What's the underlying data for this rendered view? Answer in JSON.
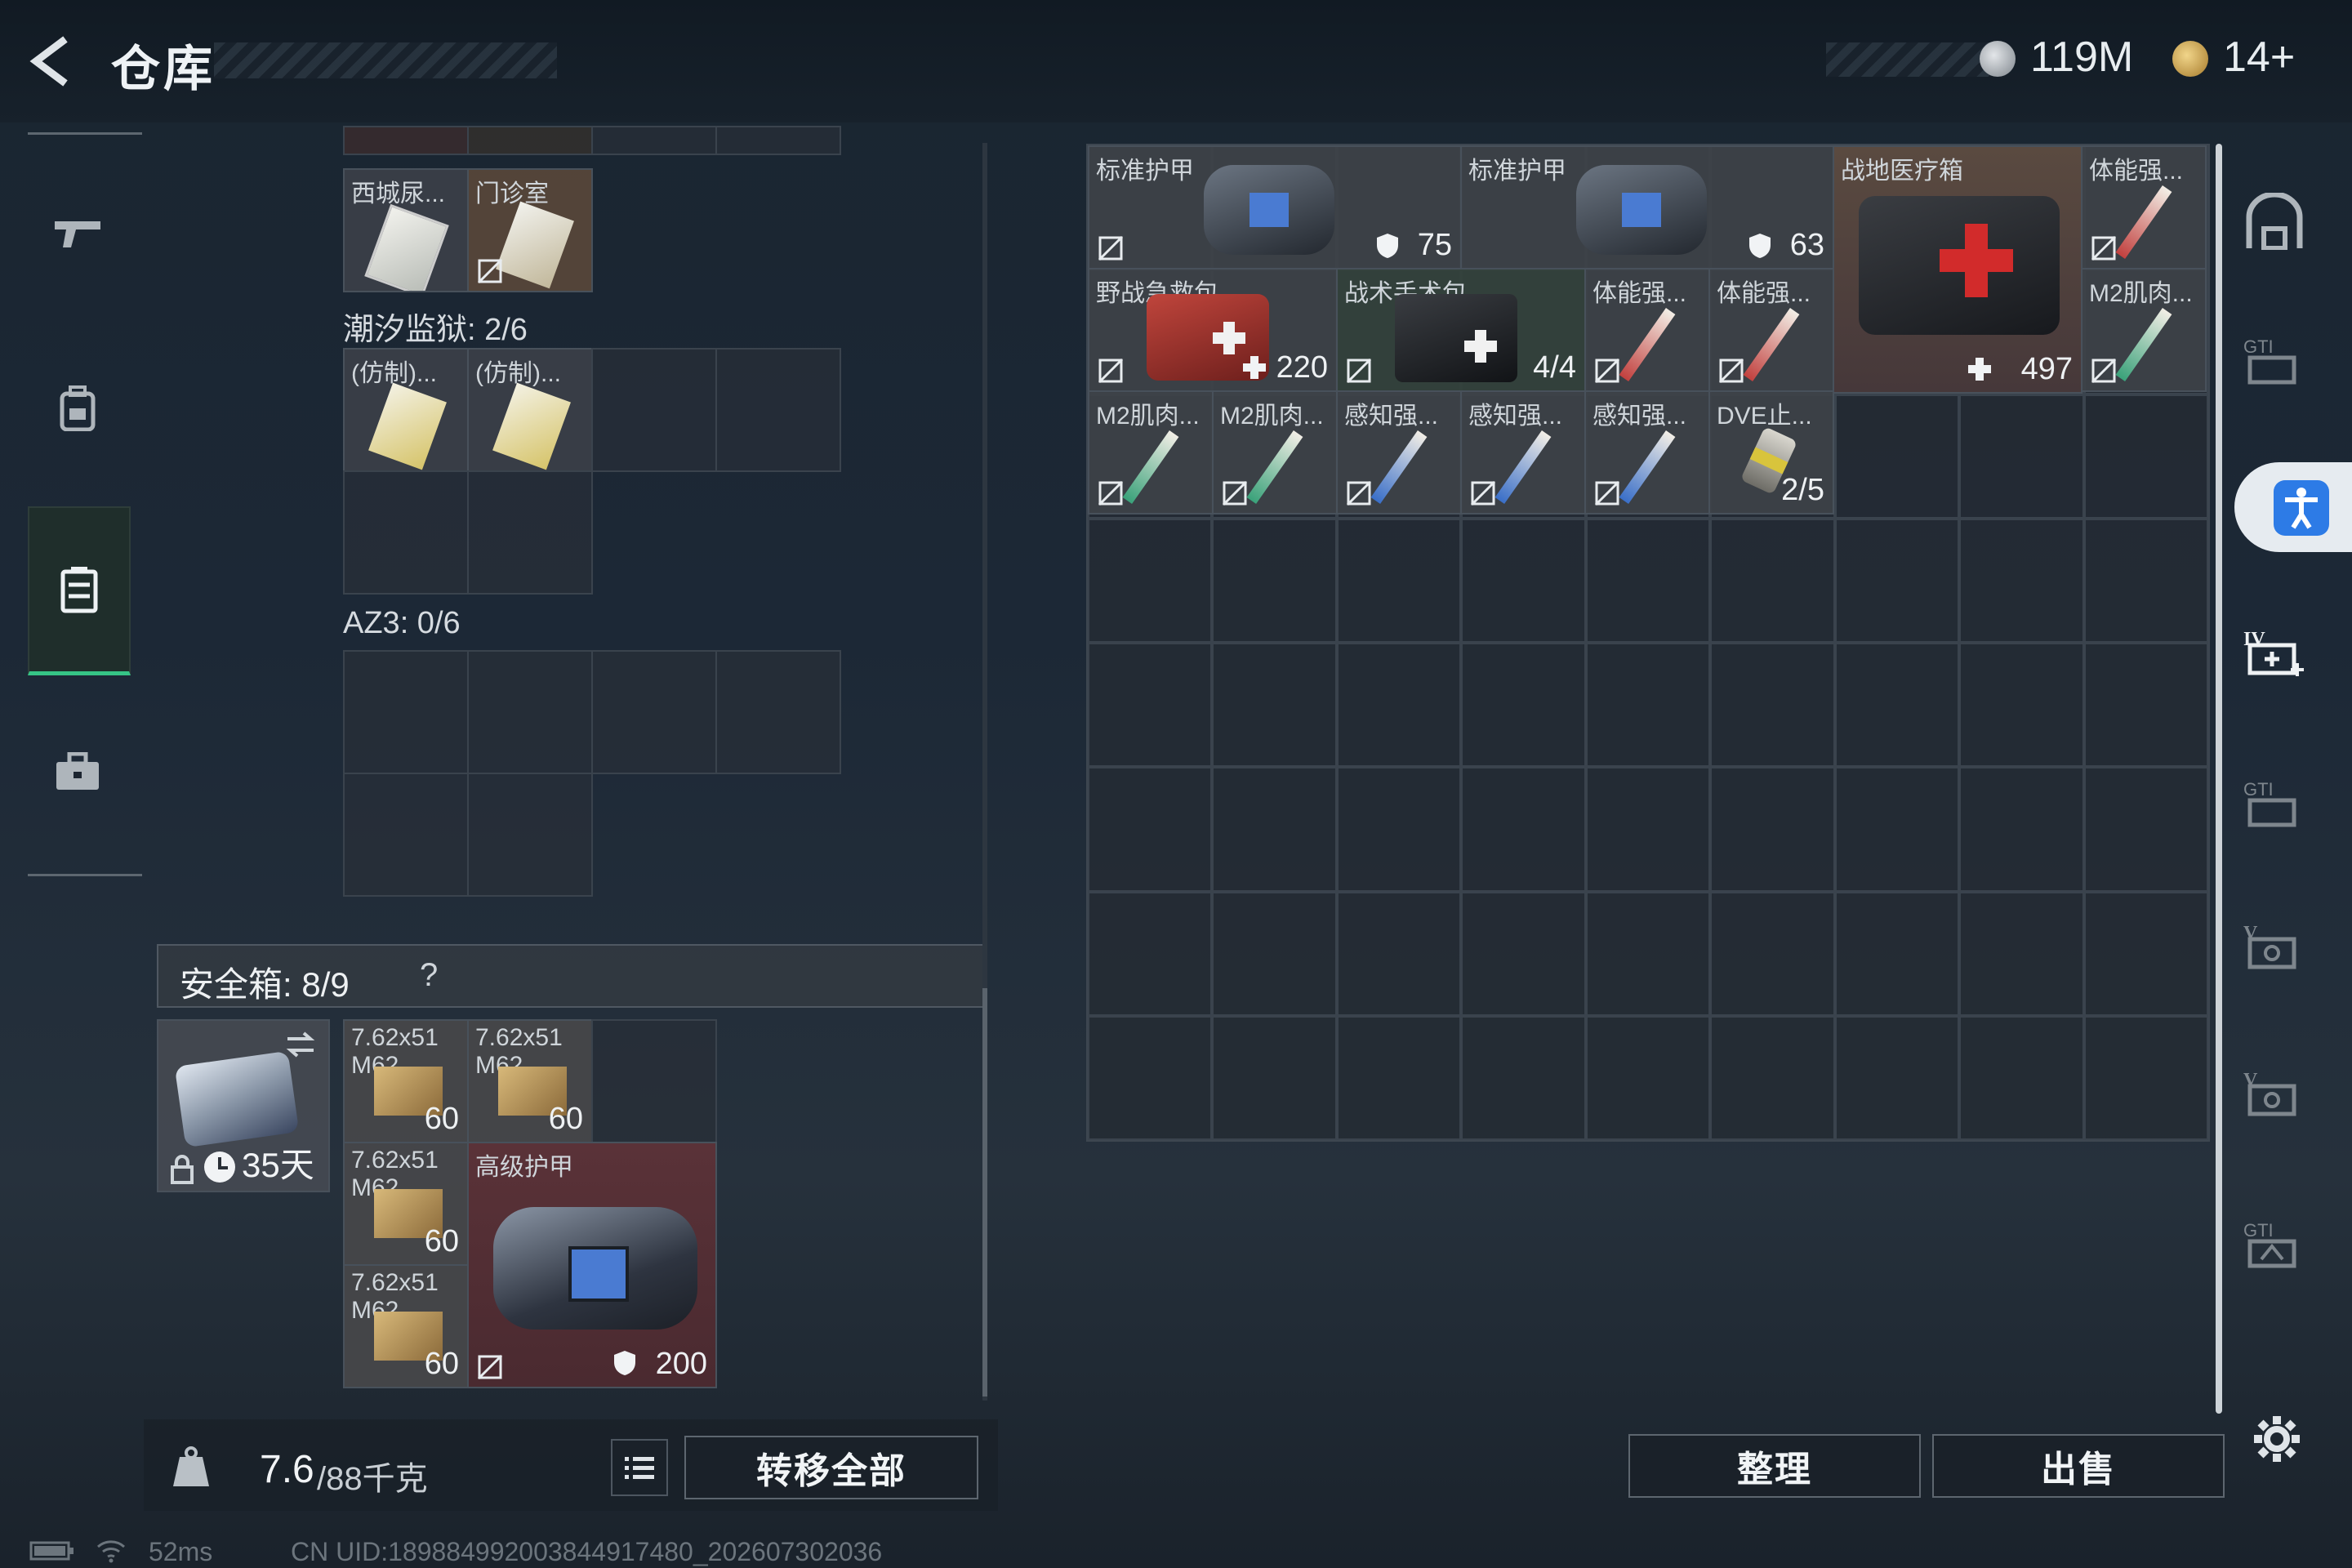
{
  "header": {
    "title": "仓库",
    "currency1": "119M",
    "currency2": "14+"
  },
  "nav": {
    "items": [
      "weapon",
      "backpack",
      "rig",
      "case"
    ]
  },
  "left": {
    "items": [
      {
        "name": "西城尿..."
      },
      {
        "name": "门诊室"
      },
      {
        "name": "(仿制)..."
      },
      {
        "name": "(仿制)..."
      }
    ],
    "section_chaoxi": "潮汐监狱: 2/6",
    "section_az3": "AZ3: 0/6",
    "safebox_label": "安全箱: 8/9",
    "safebox_help": "?",
    "safebox_days": "35天",
    "ammo": [
      {
        "name": "7.62x51",
        "sub": "M62",
        "count": "60"
      },
      {
        "name": "7.62x51",
        "sub": "M62",
        "count": "60"
      },
      {
        "name": "7.62x51",
        "sub": "M62",
        "count": "60"
      },
      {
        "name": "7.62x51",
        "sub": "M62",
        "count": "60"
      }
    ],
    "armor": {
      "name": "高级护甲",
      "value": "200"
    },
    "weight": "7.6",
    "weight_max": "/88千克",
    "transfer_btn": "转移全部"
  },
  "right": {
    "items": [
      {
        "name": "标准护甲",
        "value": "75"
      },
      {
        "name": "标准护甲",
        "value": "63"
      },
      {
        "name": "战地医疗箱",
        "value": "497"
      },
      {
        "name": "体能强..."
      },
      {
        "name": "野战急救包",
        "value": "220"
      },
      {
        "name": "战术手术包",
        "value": "4/4"
      },
      {
        "name": "体能强..."
      },
      {
        "name": "体能强..."
      },
      {
        "name": "M2肌肉..."
      },
      {
        "name": "M2肌肉..."
      },
      {
        "name": "M2肌肉..."
      },
      {
        "name": "感知强..."
      },
      {
        "name": "感知强..."
      },
      {
        "name": "感知强..."
      },
      {
        "name": "DVE止..."
      },
      {
        "name": "",
        "value": "2/5"
      }
    ],
    "sort_btn": "整理",
    "sell_btn": "出售"
  },
  "status": {
    "ping": "52ms",
    "uid": "CN UID:18988499200384491748​0_202607302036"
  },
  "colors": {
    "accent_green": "#36c486",
    "accessibility_blue": "#2d7be6"
  }
}
